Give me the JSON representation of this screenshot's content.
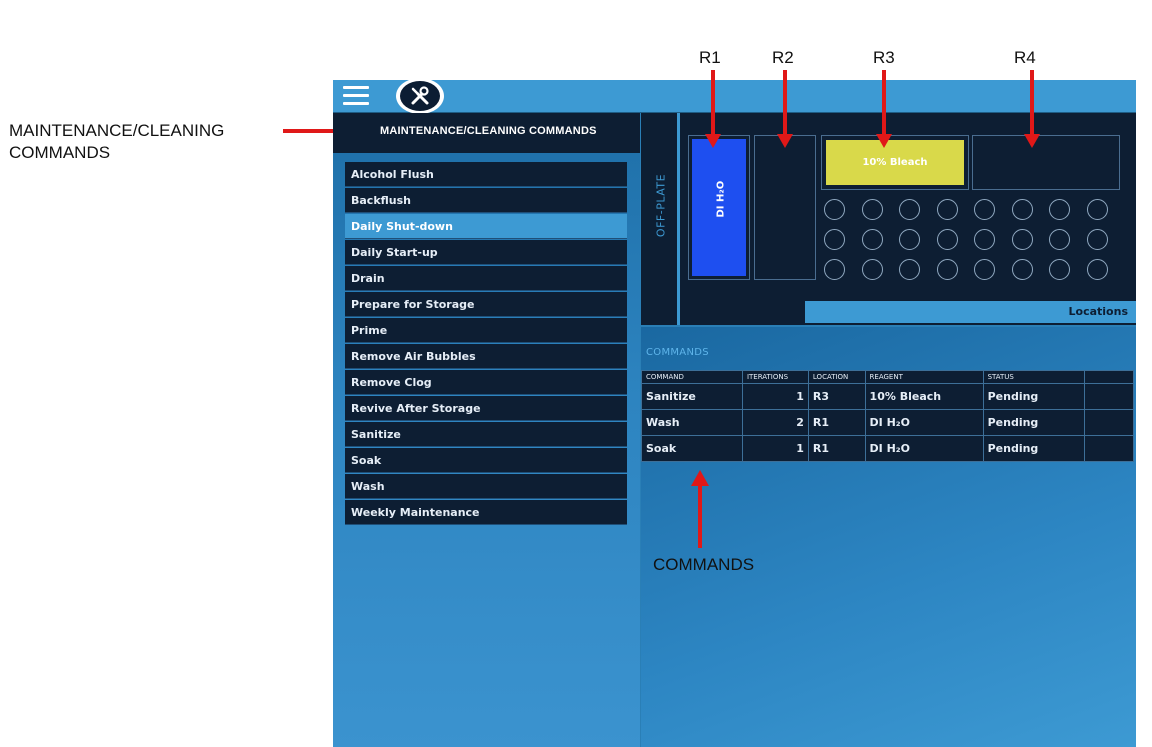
{
  "annotations": {
    "left_callout_line1": "MAINTENANCE/CLEANING",
    "left_callout_line2": "COMMANDS",
    "r1": "R1",
    "r2": "R2",
    "r3": "R3",
    "r4": "R4",
    "commands_callout": "COMMANDS"
  },
  "sidebar": {
    "title": "MAINTENANCE/CLEANING COMMANDS",
    "items": [
      {
        "label": "Alcohol Flush"
      },
      {
        "label": "Backflush"
      },
      {
        "label": "Daily Shut-down"
      },
      {
        "label": "Daily Start-up"
      },
      {
        "label": "Drain"
      },
      {
        "label": "Prepare for Storage"
      },
      {
        "label": "Prime"
      },
      {
        "label": "Remove Air Bubbles"
      },
      {
        "label": "Remove Clog"
      },
      {
        "label": "Revive After Storage"
      },
      {
        "label": "Sanitize"
      },
      {
        "label": "Soak"
      },
      {
        "label": "Wash"
      },
      {
        "label": "Weekly Maintenance"
      }
    ],
    "selected_index": 2
  },
  "plate": {
    "offplate_label": "OFF-PLATE",
    "r1_reagent": "DI H₂O",
    "r3_reagent": "10% Bleach",
    "locations_label": "Locations",
    "colors": {
      "r1": "#1e4ff0",
      "r3": "#d9d94a"
    }
  },
  "commands": {
    "label": "COMMANDS",
    "headers": [
      "COMMAND",
      "ITERATIONS",
      "LOCATION",
      "REAGENT",
      "STATUS",
      ""
    ],
    "rows": [
      [
        "Sanitize",
        "1",
        "R3",
        "10% Bleach",
        "Pending",
        ""
      ],
      [
        "Wash",
        "2",
        "R1",
        "DI H₂O",
        "Pending",
        ""
      ],
      [
        "Soak",
        "1",
        "R1",
        "DI H₂O",
        "Pending",
        ""
      ]
    ]
  }
}
